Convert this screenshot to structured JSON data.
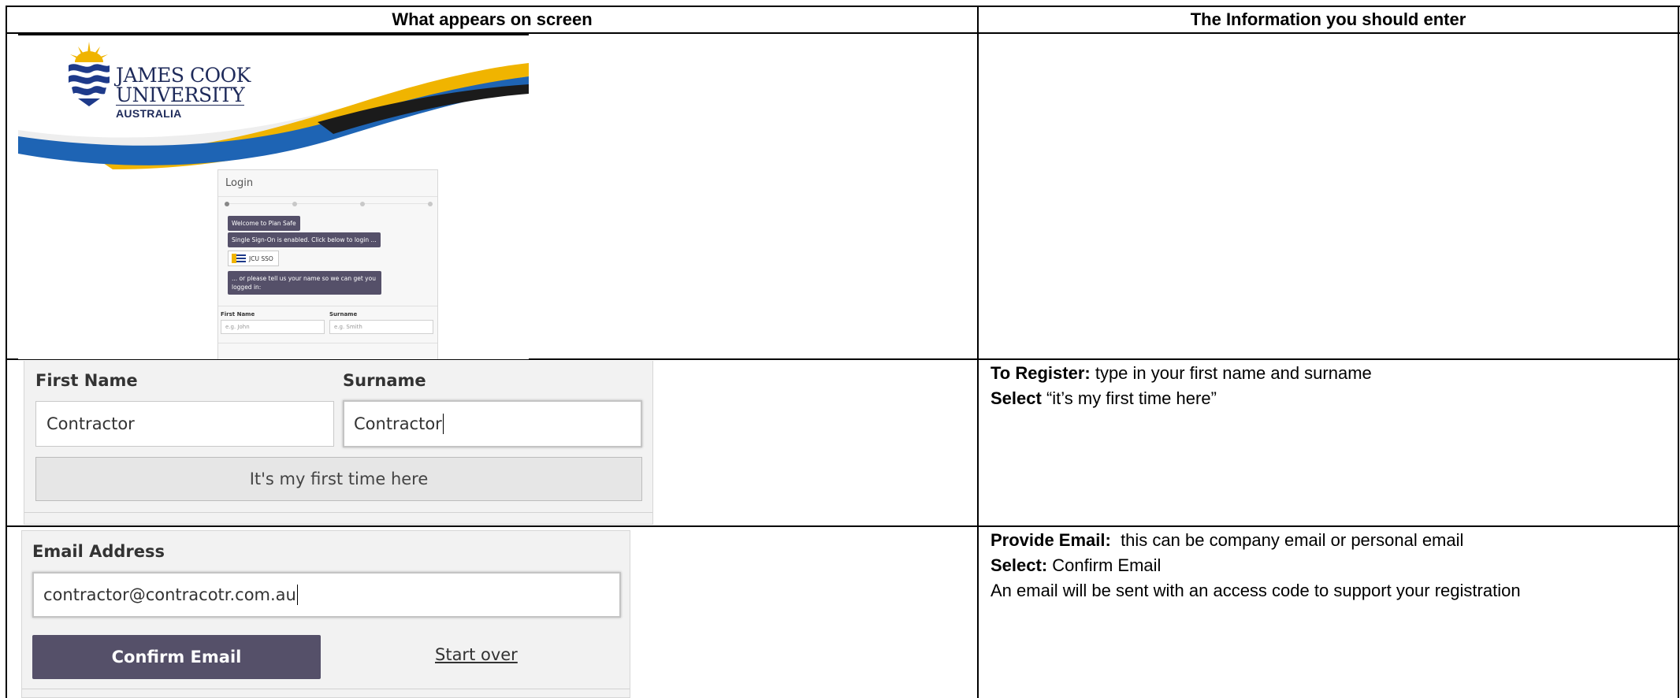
{
  "table": {
    "col1_header": "What appears on screen",
    "col2_header": "The Information you should enter"
  },
  "row1": {
    "logo": {
      "line1": "JAMES COOK",
      "line2": "UNIVERSITY",
      "line3": "AUSTRALIA"
    },
    "login": {
      "title": "Login",
      "bubble_welcome": "Welcome to Plan Safe",
      "bubble_sso": "Single Sign-On is enabled. Click below to login ...",
      "sso_button": "JCU SSO",
      "bubble_name_line1": "... or please tell us your name so we can get you",
      "bubble_name_line2": "logged in:",
      "first_name_label": "First Name",
      "first_name_placeholder": "e.g. John",
      "surname_label": "Surname",
      "surname_placeholder": "e.g. Smith"
    }
  },
  "row2": {
    "first_name_label": "First Name",
    "first_name_value": "Contractor",
    "surname_label": "Surname",
    "surname_value": "Contractor",
    "first_time_button": "It's my first time here",
    "instructions": {
      "line1_bold": "To Register:",
      "line1_text": " type in your first name and surname",
      "line2_bold": "Select",
      "line2_text": " “it’s my first time here”"
    }
  },
  "row3": {
    "email_label": "Email Address",
    "email_value": "contractor@contracotr.com.au",
    "confirm_button": "Confirm Email",
    "start_over_link": "Start over",
    "instructions": {
      "line1_bold": "Provide Email:",
      "line1_text": "  this can be company email or personal email",
      "line2_bold": "Select:",
      "line2_text": " Confirm Email",
      "line3_text": "An email will be sent with an access code to support your registration"
    }
  },
  "colors": {
    "accent_purple": "#555069",
    "jcu_blue": "#1e64b4",
    "jcu_gold": "#f0b400",
    "jcu_navy": "#1e2a5a"
  }
}
